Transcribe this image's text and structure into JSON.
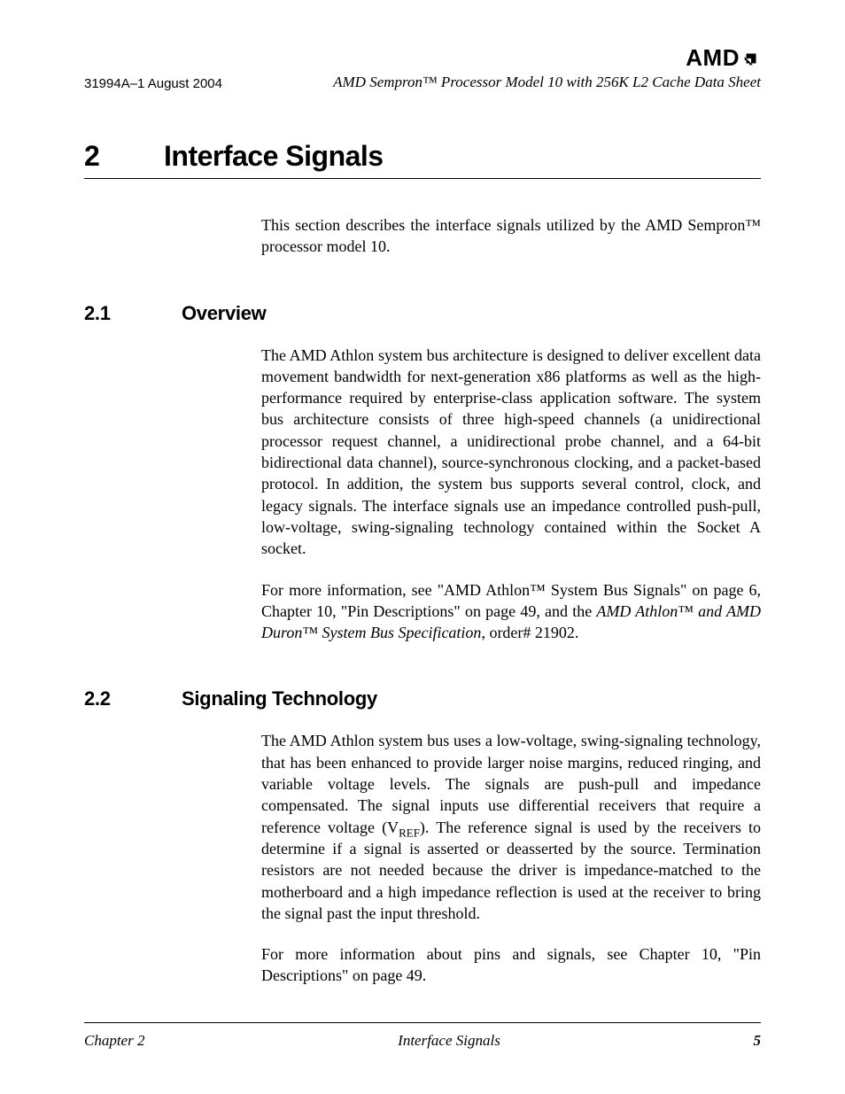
{
  "header": {
    "doc_id": "31994A–1 August 2004",
    "logo_text": "AMD",
    "doc_title": "AMD Sempron™ Processor Model 10 with 256K L2 Cache Data Sheet"
  },
  "chapter": {
    "number": "2",
    "title": "Interface Signals",
    "intro": "This section describes the interface signals utilized by the AMD Sempron™ processor model 10."
  },
  "sections": [
    {
      "number": "2.1",
      "title": "Overview",
      "paragraphs": [
        "The AMD Athlon system bus architecture is designed to deliver excellent data movement bandwidth for next-generation x86 platforms as well as the high-performance required by enterprise-class application software. The system bus architecture consists of three high-speed channels (a unidirectional processor request channel, a unidirectional probe channel, and a 64-bit bidirectional data channel), source-synchronous clocking, and a packet-based protocol. In addition, the system bus supports several control, clock, and legacy signals. The interface signals use an impedance controlled push-pull, low-voltage, swing-signaling technology contained within the Socket A socket.",
        "For more information, see \"AMD Athlon™ System Bus Signals\" on page 6, Chapter 10, \"Pin Descriptions\" on page 49, and the <span class=\"italic\">AMD Athlon™ and AMD Duron™ System Bus Specification</span>, order# 21902."
      ]
    },
    {
      "number": "2.2",
      "title": "Signaling Technology",
      "paragraphs": [
        "The AMD Athlon system bus uses a low-voltage, swing-signaling technology, that has been enhanced to provide larger noise margins, reduced ringing, and variable voltage levels. The signals are push-pull and impedance compensated. The signal inputs use differential receivers that require a reference voltage (V<span class=\"sub\">REF</span>). The reference signal is used by the receivers to determine if a signal is asserted or deasserted by the source. Termination resistors are not needed because the driver is impedance-matched to the motherboard and a high impedance reflection is used at the receiver to bring the signal past the input threshold.",
        "For more information about pins and signals, see Chapter 10, \"Pin Descriptions\" on page 49."
      ]
    }
  ],
  "footer": {
    "left": "Chapter 2",
    "center": "Interface Signals",
    "right": "5"
  }
}
